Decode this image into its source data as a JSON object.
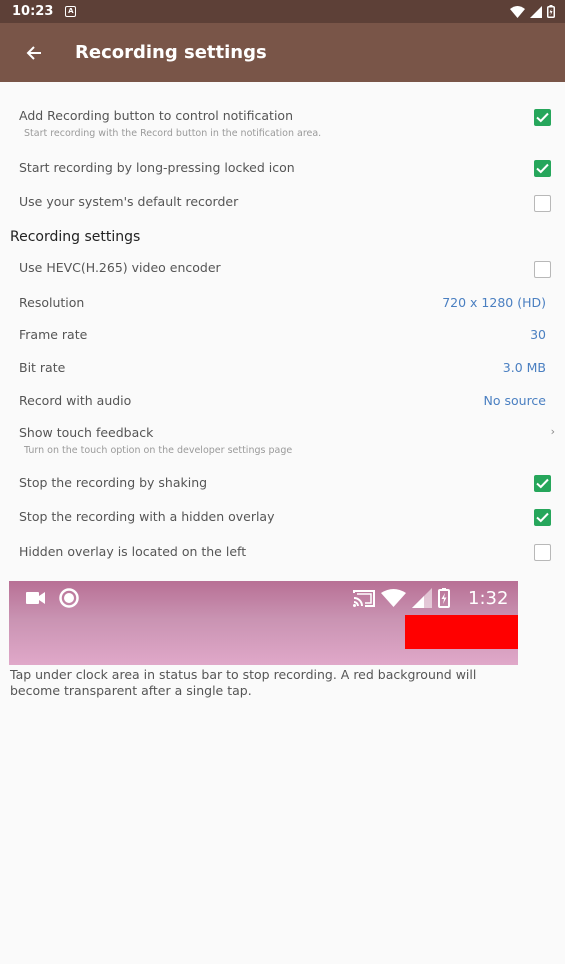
{
  "status_bar": {
    "time": "10:23",
    "a_badge": "A"
  },
  "app_bar": {
    "title": "Recording settings"
  },
  "general": [
    {
      "label": "Add Recording button to control notification",
      "summary": "Start recording with the Record button in the notification area.",
      "checked": true
    },
    {
      "label": "Start recording by long-pressing locked icon",
      "checked": true
    },
    {
      "label": "Use your system's default recorder",
      "checked": false
    }
  ],
  "recording_section": {
    "title": "Recording settings",
    "hevc": {
      "label": "Use HEVC(H.265) video encoder",
      "checked": false
    },
    "resolution": {
      "label": "Resolution",
      "value": "720 x 1280 (HD)"
    },
    "frame_rate": {
      "label": "Frame rate",
      "value": "30"
    },
    "bit_rate": {
      "label": "Bit rate",
      "value": "3.0 MB"
    },
    "audio": {
      "label": "Record with audio",
      "value": "No source"
    },
    "touch": {
      "label": "Show touch feedback",
      "summary": "Turn on the touch option on the developer settings page",
      "chevron": "›"
    },
    "shake": {
      "label": "Stop the recording by shaking",
      "checked": true
    },
    "overlay": {
      "label": "Stop the recording with a hidden overlay",
      "checked": true
    },
    "overlay_left": {
      "label": "Hidden overlay is located on the left",
      "checked": false
    }
  },
  "preview": {
    "time": "1:32"
  },
  "note": "Tap under clock area in status bar to stop recording. A red background will become transparent after a single tap.",
  "colors": {
    "status_bar": "#5d4037",
    "app_bar": "#795548",
    "checkbox_on": "#26a65b",
    "value_text": "#4a7fc1",
    "overlay_red": "#ff0000"
  }
}
